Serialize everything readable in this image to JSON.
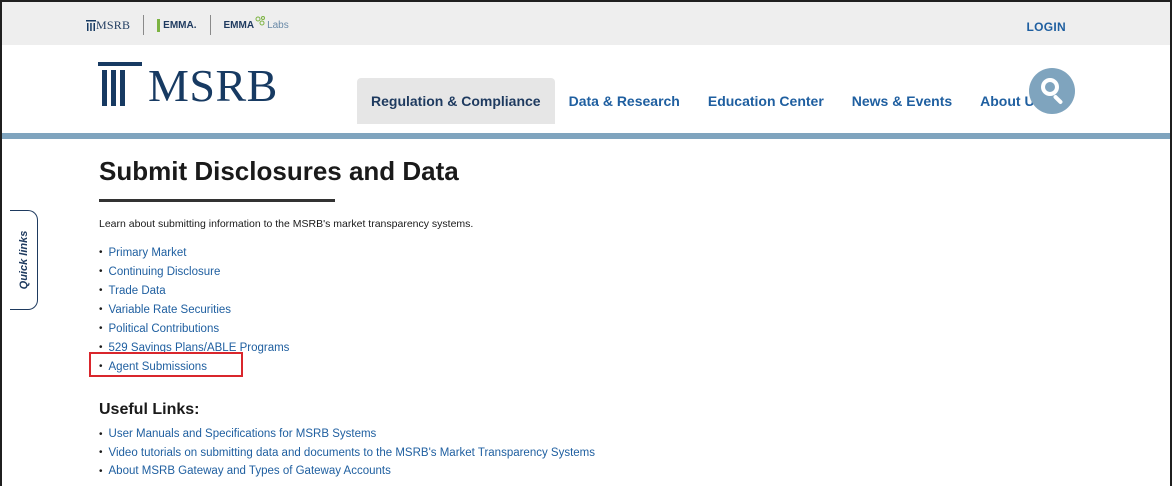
{
  "utility_bar": {
    "logos": [
      {
        "name": "MSRB",
        "label": "MSRB"
      },
      {
        "name": "EMMA",
        "label": "EMMA."
      },
      {
        "name": "EMMA Labs",
        "label": "EMMA",
        "sub": "Labs"
      }
    ],
    "login_label": "LOGIN"
  },
  "header": {
    "brand_text": "MSRB",
    "nav": [
      {
        "label": "Regulation & Compliance",
        "active": true
      },
      {
        "label": "Data & Research",
        "active": false
      },
      {
        "label": "Education Center",
        "active": false
      },
      {
        "label": "News & Events",
        "active": false
      },
      {
        "label": "About Us",
        "active": false
      }
    ],
    "search_icon": "search-icon"
  },
  "quick_links": {
    "label": "Quick links"
  },
  "main": {
    "title": "Submit Disclosures and Data",
    "intro": "Learn about submitting information to the MSRB's market transparency systems.",
    "links": [
      "Primary Market",
      "Continuing Disclosure",
      "Trade Data",
      "Variable Rate Securities",
      "Political Contributions",
      "529 Savings Plans/ABLE Programs",
      "Agent Submissions"
    ],
    "useful_heading": "Useful Links:",
    "useful_links": [
      "User Manuals and Specifications for MSRB Systems",
      "Video tutorials on submitting data and documents to the MSRB's Market Transparency Systems",
      "About MSRB Gateway and Types of Gateway Accounts"
    ]
  },
  "colors": {
    "link": "#1f5fa0",
    "brand_navy": "#173a62",
    "accent_blue": "#7fa4be",
    "highlight_red": "#d9262c"
  }
}
